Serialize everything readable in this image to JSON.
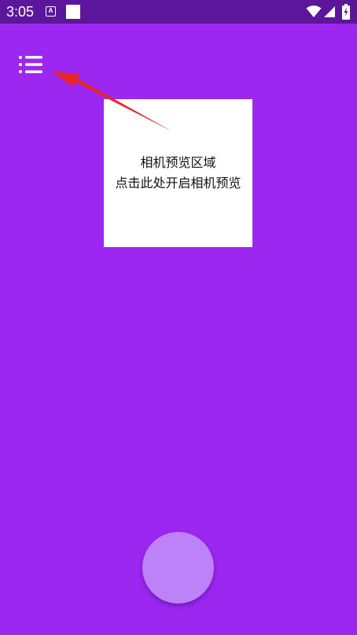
{
  "status_bar": {
    "time": "3:05",
    "notification_icons": [
      "keyboard-a-icon",
      "white-square-icon"
    ],
    "system_icons": [
      "wifi-icon",
      "signal-icon",
      "battery-charging-icon"
    ],
    "notif_a_label": "A"
  },
  "colors": {
    "status_bar_bg": "#5c169b",
    "app_bg": "#9b27f0",
    "preview_bg": "#ffffff",
    "shutter": "#bd82f8",
    "arrow": "#e8262a"
  },
  "toolbar": {
    "menu_icon": "list-menu-icon"
  },
  "preview": {
    "line1": "相机预览区域",
    "line2": "点击此处开启相机预览"
  },
  "shutter": {
    "icon": "capture-button"
  }
}
